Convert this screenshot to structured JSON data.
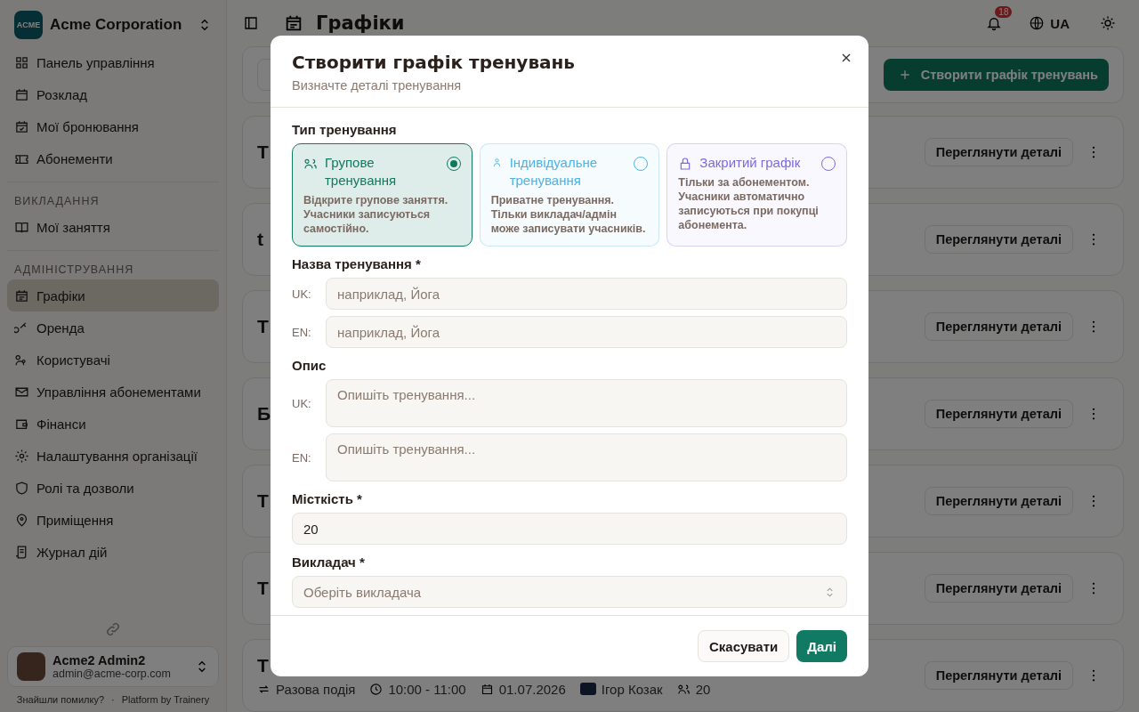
{
  "sidebar": {
    "logo_text": "ACME",
    "organization": "Acme Corporation",
    "sections": [
      {
        "items": [
          {
            "label": "Панель управління",
            "selected": false
          },
          {
            "label": "Розклад",
            "selected": false
          },
          {
            "label": "Мої бронювання",
            "selected": false
          },
          {
            "label": "Абонементи",
            "selected": false
          }
        ]
      },
      {
        "heading": "ВИКЛАДАННЯ",
        "items": [
          {
            "label": "Мої заняття",
            "selected": false
          }
        ]
      },
      {
        "heading": "АДМІНІСТРУВАННЯ",
        "items": [
          {
            "label": "Графіки",
            "selected": true
          },
          {
            "label": "Оренда",
            "selected": false
          },
          {
            "label": "Користувачі",
            "selected": false
          },
          {
            "label": "Управління абонементами",
            "selected": false
          },
          {
            "label": "Фінанси",
            "selected": false
          },
          {
            "label": "Налаштування організації",
            "selected": false
          },
          {
            "label": "Ролі та дозволи",
            "selected": false
          },
          {
            "label": "Приміщення",
            "selected": false
          },
          {
            "label": "Журнал дій",
            "selected": false
          }
        ]
      }
    ],
    "user": {
      "name": "Acme2 Admin2",
      "email": "admin@acme-corp.com"
    },
    "footer": {
      "report_link": "Знайшли помилку?",
      "separator": "·",
      "credit": "Platform by Trainery"
    }
  },
  "header": {
    "title": "Графіки",
    "notifications_count": "18",
    "language": "UA"
  },
  "toolbar": {
    "create_button": "Створити графік тренувань"
  },
  "cards": [
    {
      "title": "Т",
      "details_button": "Переглянути деталі"
    },
    {
      "title": "t",
      "details_button": "Переглянути деталі"
    },
    {
      "title": "Т",
      "details_button": "Переглянути деталі"
    },
    {
      "title": "Б",
      "details_button": "Переглянути деталі"
    },
    {
      "title": "Т",
      "details_button": "Переглянути деталі"
    },
    {
      "title": "Т",
      "details_button": "Переглянути деталі"
    },
    {
      "title": "Т",
      "details_button": "Переглянути деталі",
      "meta": {
        "recurrence": "Разова подія",
        "time": "10:00 - 11:00",
        "date": "01.07.2026",
        "teacher": "Ігор Козак",
        "capacity": "20"
      }
    }
  ],
  "dialog": {
    "title": "Створити графік тренувань",
    "subtitle": "Визначте деталі тренування",
    "type_label": "Тип тренування",
    "types": [
      {
        "kind": "group",
        "title": "Групове тренування",
        "description": "Відкрите групове заняття. Учасники записуються самостійно.",
        "color": "#0f7a5f",
        "selected": true
      },
      {
        "kind": "individual",
        "title": "Індивідуальне тренування",
        "description": "Приватне тренування. Тільки викладач/адмін може записувати учасників.",
        "color": "#4ab3e8",
        "selected": false
      },
      {
        "kind": "closed",
        "title": "Закритий графік",
        "description": "Тільки за абонементом. Учасники автоматично записуються при покупці абонемента.",
        "color": "#7c6ae0",
        "selected": false
      }
    ],
    "name_label": "Назва тренування *",
    "name_fields": [
      {
        "lang": "UK:",
        "placeholder": "наприклад, Йога"
      },
      {
        "lang": "EN:",
        "placeholder": "наприклад, Йога"
      }
    ],
    "description_label": "Опис",
    "description_fields": [
      {
        "lang": "UK:",
        "placeholder": "Опишіть тренування..."
      },
      {
        "lang": "EN:",
        "placeholder": "Опишіть тренування..."
      }
    ],
    "capacity_label": "Місткість *",
    "capacity_value": "20",
    "teacher_label": "Викладач *",
    "teacher_placeholder": "Оберіть викладача",
    "cancel_button": "Скасувати",
    "next_button": "Далі"
  }
}
